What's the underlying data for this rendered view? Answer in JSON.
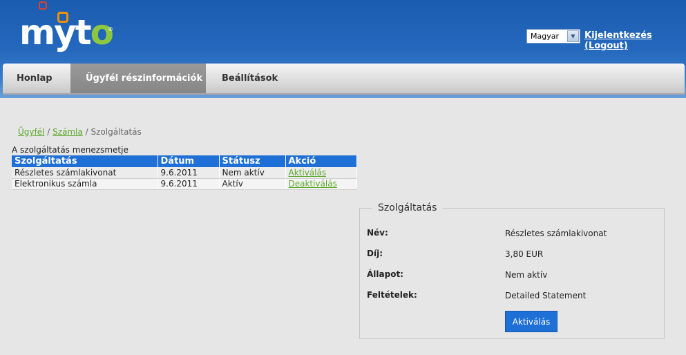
{
  "header": {
    "logo_text": "myto",
    "logo_reg": "®",
    "language": "Magyar",
    "logout_label": "Kijelentkezés (Logout)"
  },
  "nav": {
    "items": [
      {
        "label": "Honlap"
      },
      {
        "label": "Ügyfél részinformációk"
      },
      {
        "label": "Beállítások"
      }
    ]
  },
  "breadcrumb": {
    "items": [
      "Ügyfél",
      "Számla",
      "Szolgáltatás"
    ],
    "separator": "/"
  },
  "services_table": {
    "caption": "A szolgáltatás menezsmetje",
    "headers": [
      "Szolgáltatás",
      "Dátum",
      "Státusz",
      "Akció"
    ],
    "rows": [
      {
        "service": "Részletes számlakivonat",
        "date": "9.6.2011",
        "status": "Nem aktív",
        "action": "Aktiválás"
      },
      {
        "service": "Elektronikus számla",
        "date": "9.6.2011",
        "status": "Aktív",
        "action": "Deaktiválás"
      }
    ]
  },
  "detail_panel": {
    "title": "Szolgáltatás",
    "fields": [
      {
        "label": "Név:",
        "value": "Részletes számlakivonat"
      },
      {
        "label": "Díj:",
        "value": "3,80 EUR"
      },
      {
        "label": "Állapot:",
        "value": "Nem aktív"
      },
      {
        "label": "Feltételek:",
        "value": "Detailed Statement"
      }
    ],
    "button_label": "Aktiválás"
  },
  "colors": {
    "header_blue": "#1a5cb0",
    "accent_blue": "#1e6fd6",
    "link_green": "#5ca72a",
    "logo_green": "#8dc63f"
  }
}
